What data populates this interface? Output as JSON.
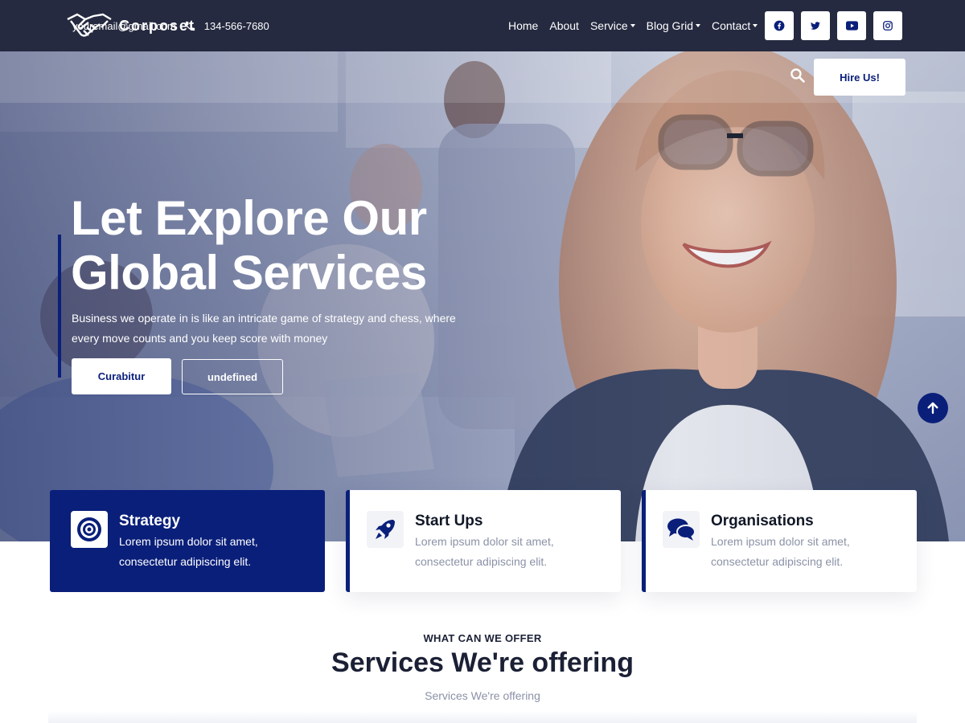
{
  "topbar": {
    "email": "youremail@gmail.com",
    "phone": "134-566-7680",
    "socials": [
      "facebook-icon",
      "twitter-icon",
      "youtube-icon",
      "instagram-icon"
    ]
  },
  "navbar": {
    "logo_text": "Corposet",
    "links": [
      {
        "label": "Home",
        "dropdown": false
      },
      {
        "label": "About",
        "dropdown": false
      },
      {
        "label": "Service",
        "dropdown": true
      },
      {
        "label": "Blog Grid",
        "dropdown": true
      },
      {
        "label": "Contact",
        "dropdown": true
      }
    ],
    "search_icon": "search-icon",
    "cta_label": "Hire Us!"
  },
  "hero": {
    "title_line1": "Let Explore Our",
    "title_line2": "Global Services",
    "description_line1": "Business we operate in is like an intricate game of strategy and chess, where",
    "description_line2": "every move counts and you keep score with money",
    "primary_button": "Curabitur",
    "secondary_button": "undefined"
  },
  "cards": [
    {
      "title": "Strategy",
      "text_line1": "Lorem ipsum dolor sit amet,",
      "text_line2": "consectetur adipiscing elit.",
      "icon": "target-icon",
      "active": true
    },
    {
      "title": "Start Ups",
      "text_line1": "Lorem ipsum dolor sit amet,",
      "text_line2": "consectetur adipiscing elit.",
      "icon": "rocket-icon",
      "active": false
    },
    {
      "title": "Organisations",
      "text_line1": "Lorem ipsum dolor sit amet,",
      "text_line2": "consectetur adipiscing elit.",
      "icon": "chat-bubbles-icon",
      "active": false
    }
  ],
  "section": {
    "eyebrow": "WHAT CAN WE OFFER",
    "title": "Services We're offering",
    "subtitle": "Services We're offering"
  },
  "colors": {
    "topbar": "#252a40",
    "brand": "#0a1f7a",
    "text_dark": "#1b2035",
    "text_muted": "#8b92a7"
  }
}
